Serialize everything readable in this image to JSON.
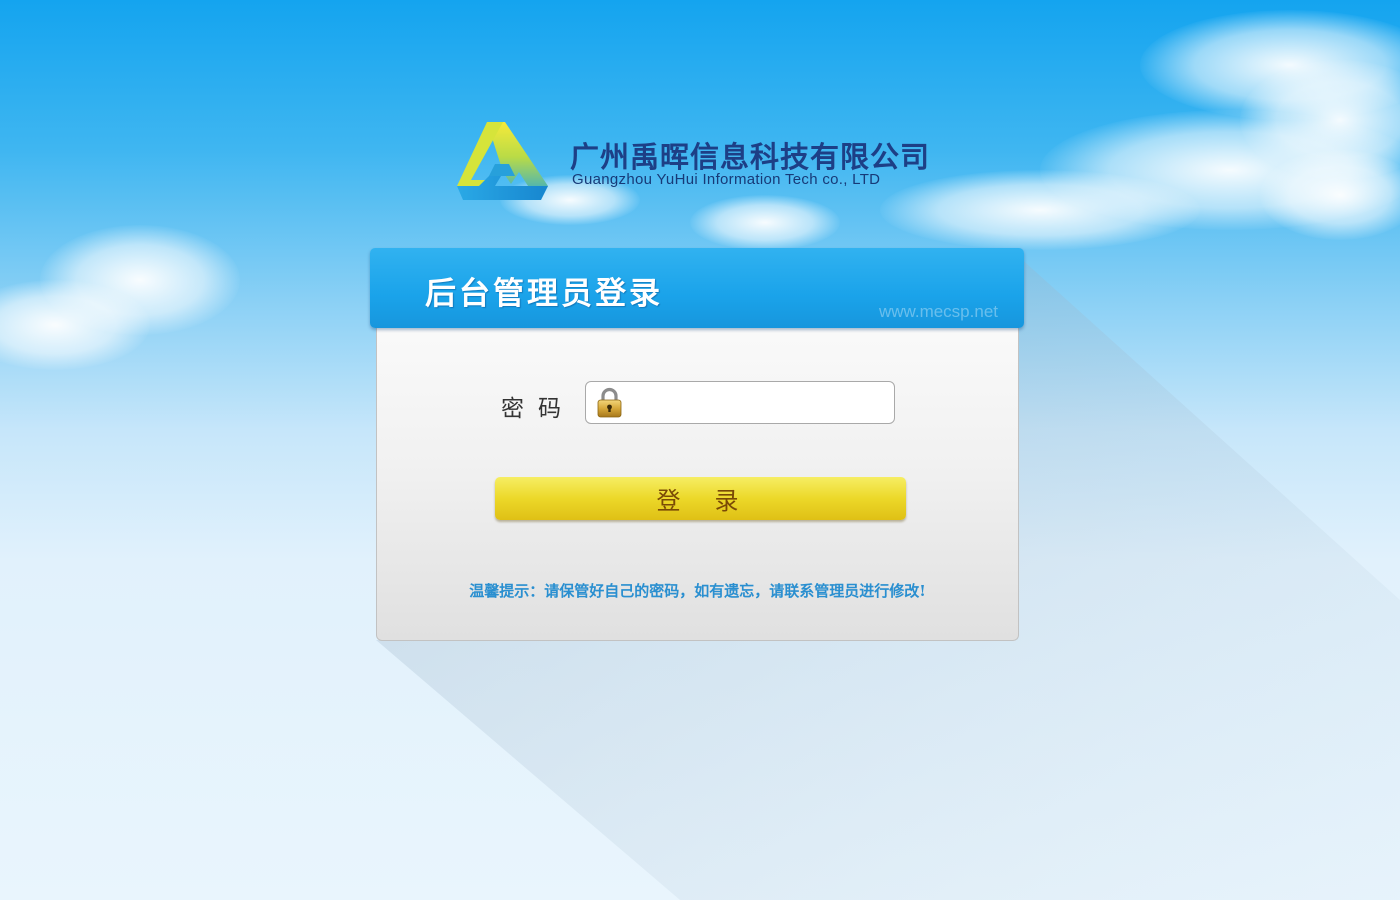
{
  "logo": {
    "company_cn": "广州禹晖信息科技有限公司",
    "company_en": "Guangzhou YuHui Information Tech co., LTD",
    "icon": "triangle-logo-icon",
    "colors": [
      "#f5e63a",
      "#62c66a",
      "#1a9fe0"
    ]
  },
  "login": {
    "title": "后台管理员登录",
    "watermark": "www.mecsp.net",
    "password_label": "密码",
    "password_value": "",
    "password_placeholder": "",
    "lock_icon": "padlock-icon",
    "submit_label": "登录",
    "tip": "温馨提示：请保管好自己的密码，如有遗忘，请联系管理员进行修改!"
  },
  "colors": {
    "header_blue": "#1aa3ea",
    "button_yellow": "#ecd829",
    "button_text": "#7a4a06",
    "tip_text": "#2a8fd0",
    "logo_text": "#1d3f86"
  }
}
